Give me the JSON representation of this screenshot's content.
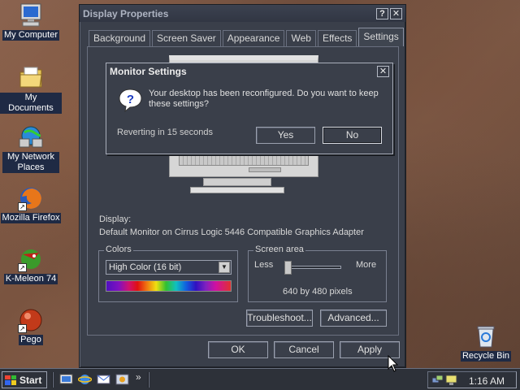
{
  "desktop": {
    "icons": [
      {
        "label": "My Computer",
        "icon": "computer-icon"
      },
      {
        "label": "My Documents",
        "icon": "folder-documents-icon"
      },
      {
        "label": "My Network Places",
        "icon": "network-places-icon"
      },
      {
        "label": "Mozilla Firefox",
        "icon": "firefox-icon"
      },
      {
        "label": "K-Meleon 74",
        "icon": "k-meleon-icon"
      },
      {
        "label": "Pego",
        "icon": "pego-icon"
      },
      {
        "label": "Recycle Bin",
        "icon": "recycle-bin-icon"
      }
    ]
  },
  "display_properties": {
    "title": "Display Properties",
    "help_btn": "?",
    "close_btn": "✕",
    "tabs": [
      "Background",
      "Screen Saver",
      "Appearance",
      "Web",
      "Effects",
      "Settings"
    ],
    "active_tab": "Settings",
    "display_label": "Display:",
    "adapter": "Default Monitor on Cirrus Logic 5446 Compatible Graphics Adapter",
    "colors": {
      "title": "Colors",
      "selected": "High Color (16 bit)"
    },
    "screen_area": {
      "title": "Screen area",
      "less": "Less",
      "more": "More",
      "value": "640 by 480 pixels",
      "slider_level": 0
    },
    "buttons": {
      "troubleshoot": "Troubleshoot...",
      "advanced": "Advanced...",
      "ok": "OK",
      "cancel": "Cancel",
      "apply": "Apply"
    }
  },
  "monitor_settings": {
    "title": "Monitor Settings",
    "close_btn": "✕",
    "message": "Your desktop has been reconfigured.  Do you want to keep these settings?",
    "reverting": "Reverting in 15 seconds",
    "yes": "Yes",
    "no": "No"
  },
  "taskbar": {
    "start_label": "Start",
    "clock": "1:16 AM",
    "chevron": "»"
  },
  "colors": {
    "dialog_bg": "#3a3f4a",
    "desktop_label_bg": "#1f2a44"
  }
}
